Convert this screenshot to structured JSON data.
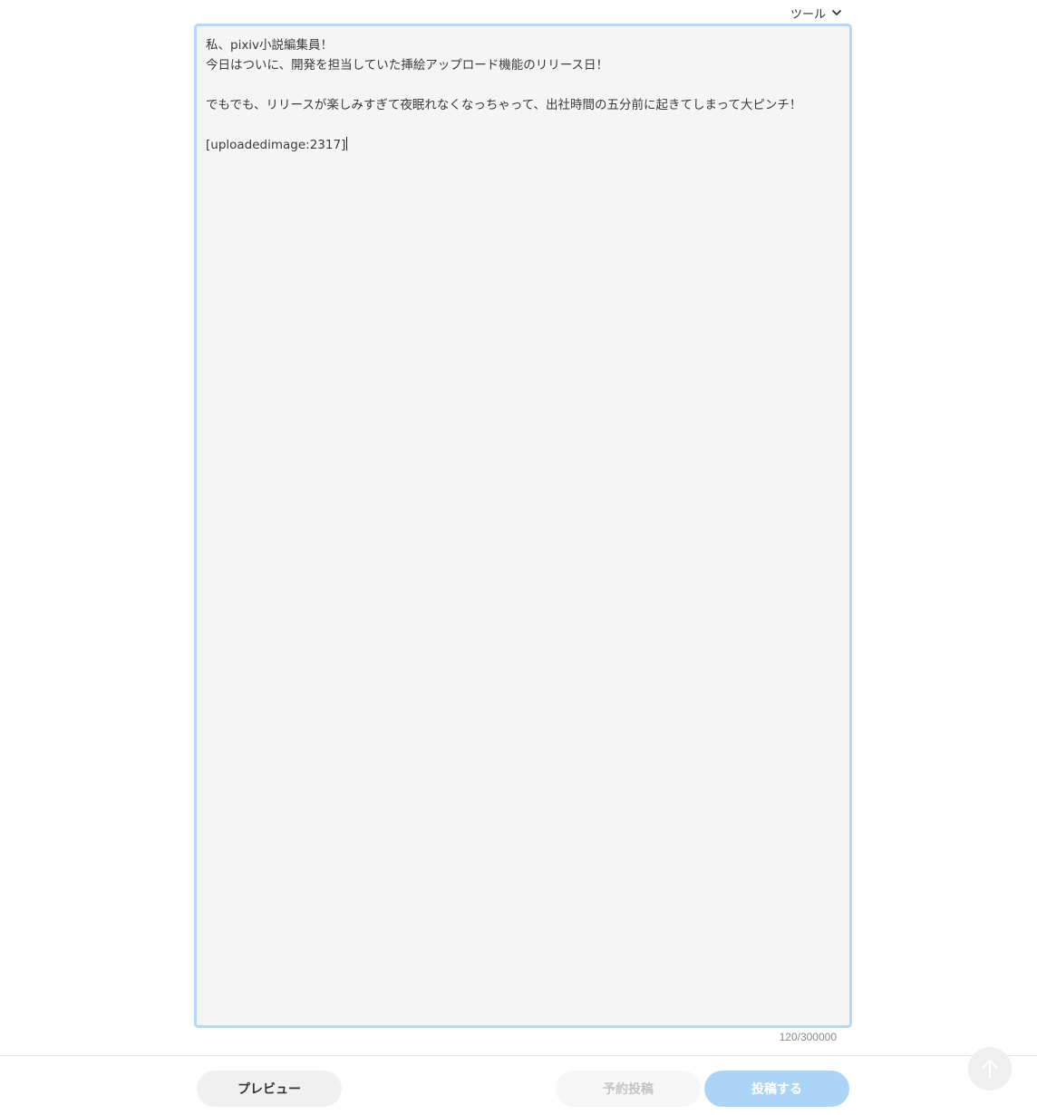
{
  "toolbar": {
    "tools_label": "ツール",
    "tools_icon": "chevron-down-icon"
  },
  "editor": {
    "content": "私、pixiv小説編集員！\n今日はついに、開発を担当していた挿絵アップロード機能のリリース日！\n\nでもでも、リリースが楽しみすぎて夜眠れなくなっちゃって、出社時間の五分前に起きてしまって大ピンチ！\n\n[uploadedimage:2317]",
    "char_count": "120/300000",
    "border_color": "#b6d8f9",
    "background_color": "#f5f5f5"
  },
  "footer": {
    "preview_label": "プレビュー",
    "schedule_label": "予約投稿",
    "submit_label": "投稿する",
    "submit_color": "#acd4f7",
    "scroll_top_icon": "arrow-up-icon"
  }
}
